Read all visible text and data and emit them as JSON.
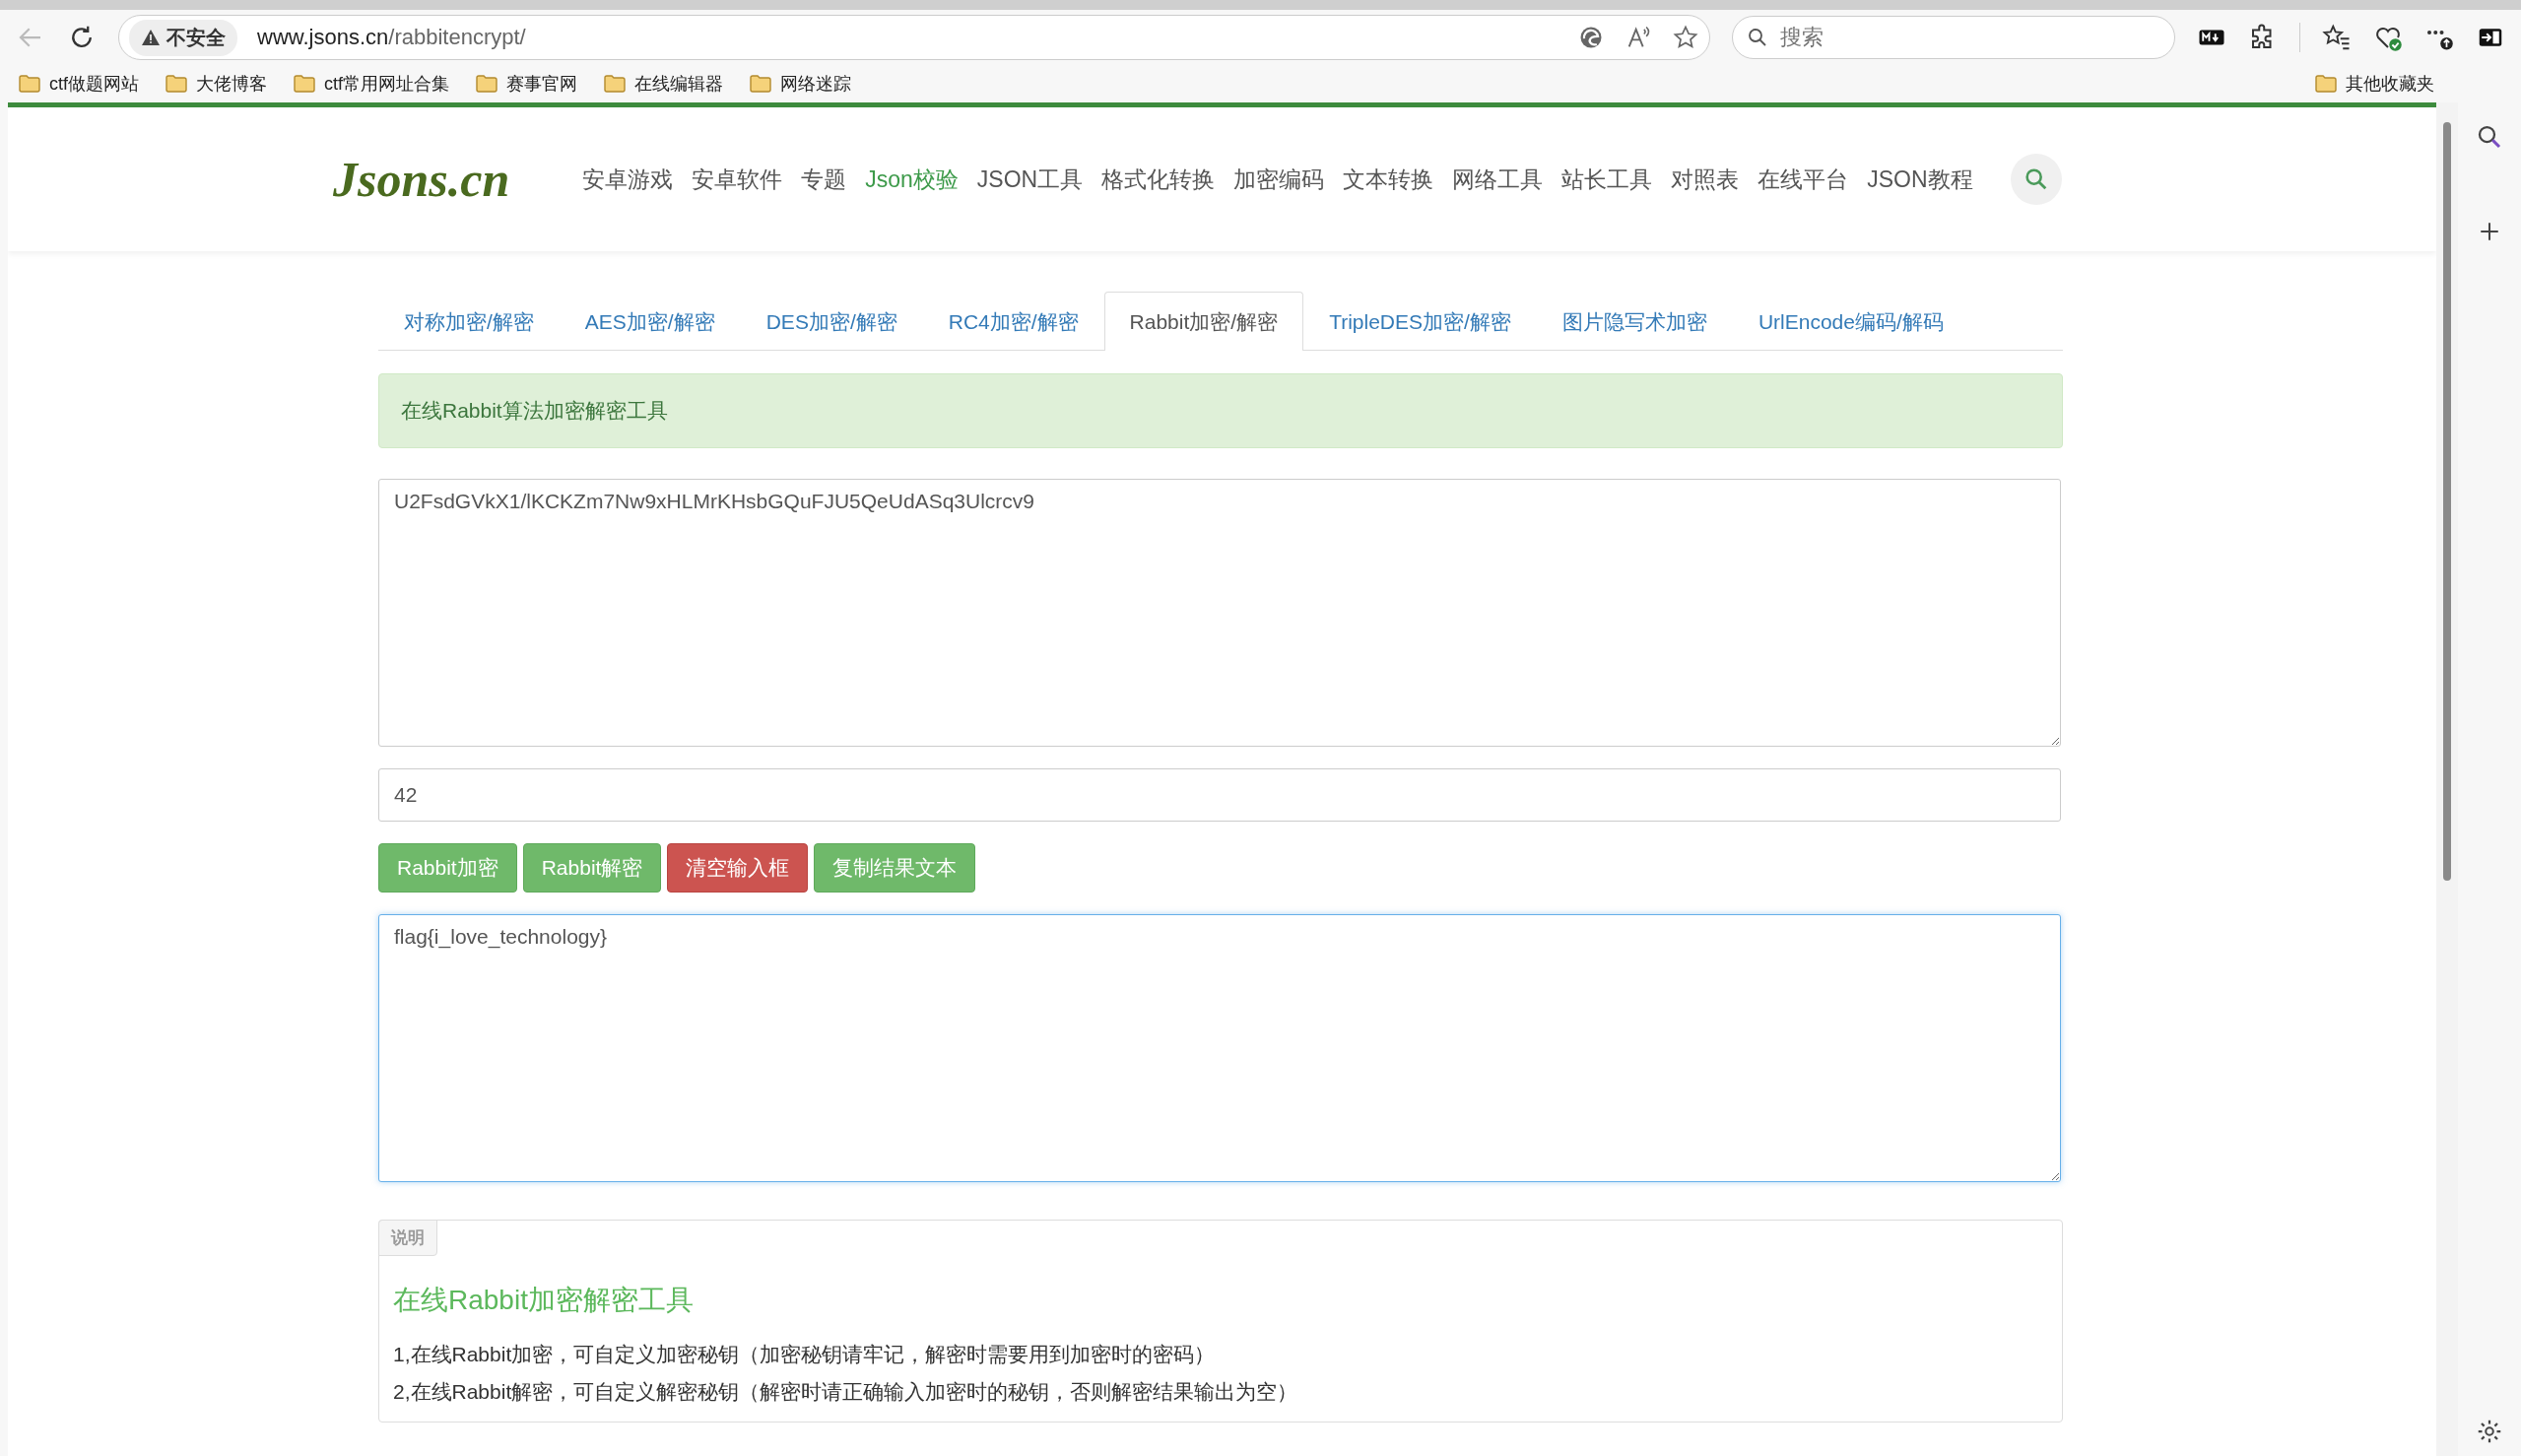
{
  "browser": {
    "security_label": "不安全",
    "url_host": "www.jsons.cn",
    "url_path": "/rabbitencrypt/",
    "search_placeholder": "搜索",
    "bookmarks": [
      "ctf做题网站",
      "大佬博客",
      "ctf常用网址合集",
      "赛事官网",
      "在线编辑器",
      "网络迷踪"
    ],
    "other_bookmarks": "其他收藏夹"
  },
  "site": {
    "logo": "Jsons.cn",
    "nav": [
      {
        "label": "安卓游戏",
        "selected": false
      },
      {
        "label": "安卓软件",
        "selected": false
      },
      {
        "label": "专题",
        "selected": false
      },
      {
        "label": "Json校验",
        "selected": true
      },
      {
        "label": "JSON工具",
        "selected": false
      },
      {
        "label": "格式化转换",
        "selected": false
      },
      {
        "label": "加密编码",
        "selected": false
      },
      {
        "label": "文本转换",
        "selected": false
      },
      {
        "label": "网络工具",
        "selected": false
      },
      {
        "label": "站长工具",
        "selected": false
      },
      {
        "label": "对照表",
        "selected": false
      },
      {
        "label": "在线平台",
        "selected": false
      },
      {
        "label": "JSON教程",
        "selected": false
      }
    ]
  },
  "tabs": [
    {
      "label": "对称加密/解密",
      "selected": false
    },
    {
      "label": "AES加密/解密",
      "selected": false
    },
    {
      "label": "DES加密/解密",
      "selected": false
    },
    {
      "label": "RC4加密/解密",
      "selected": false
    },
    {
      "label": "Rabbit加密/解密",
      "selected": true
    },
    {
      "label": "TripleDES加密/解密",
      "selected": false
    },
    {
      "label": "图片隐写术加密",
      "selected": false
    },
    {
      "label": "UrlEncode编码/解码",
      "selected": false
    }
  ],
  "alert": "在线Rabbit算法加密解密工具",
  "input_text": "U2FsdGVkX1/lKCKZm7Nw9xHLMrKHsbGQuFJU5QeUdASq3Ulcrcv9",
  "key": "42",
  "buttons": [
    {
      "label": "Rabbit加密",
      "kind": "success"
    },
    {
      "label": "Rabbit解密",
      "kind": "success"
    },
    {
      "label": "清空输入框",
      "kind": "danger"
    },
    {
      "label": "复制结果文本",
      "kind": "success"
    }
  ],
  "output": {
    "value": "flag{i_love_technology}",
    "focused": true
  },
  "explain": {
    "badge": "说明",
    "heading": "在线Rabbit加密解密工具",
    "lines": [
      "1,在线Rabbit加密，可自定义加密秘钥（加密秘钥请牢记，解密时需要用到加密时的密码）",
      "2,在线Rabbit解密，可自定义解密秘钥（解密时请正确输入加密时的秘钥，否则解密结果输出为空）"
    ]
  }
}
